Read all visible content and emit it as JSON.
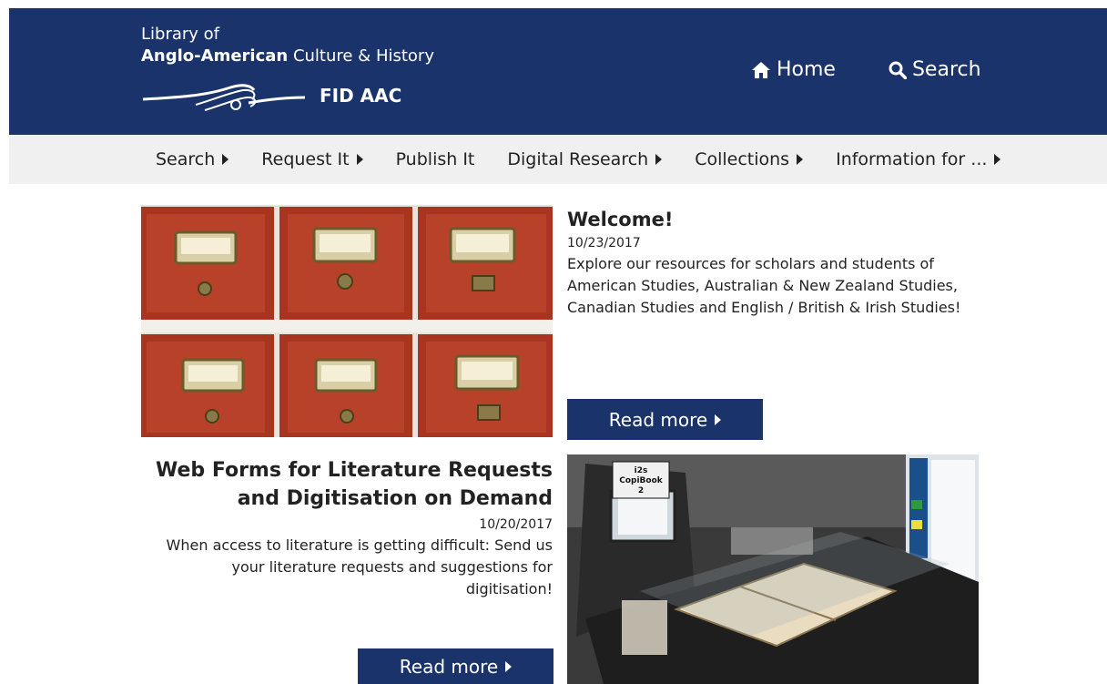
{
  "header": {
    "brand_line1": "Library of",
    "brand_line2_bold": "Anglo-American",
    "brand_line2_rest": " Culture & History",
    "brand_short": "FID AAC",
    "nav": [
      {
        "label": "Home",
        "icon": "home-icon"
      },
      {
        "label": "Search",
        "icon": "search-icon"
      }
    ]
  },
  "menu": {
    "items": [
      {
        "label": "Search",
        "has_arrow": true
      },
      {
        "label": "Request It",
        "has_arrow": true
      },
      {
        "label": "Publish It",
        "has_arrow": false
      },
      {
        "label": "Digital Research",
        "has_arrow": true
      },
      {
        "label": "Collections",
        "has_arrow": true
      },
      {
        "label": "Information for ...",
        "has_arrow": true
      }
    ]
  },
  "posts": [
    {
      "title": "Welcome!",
      "date": "10/23/2017",
      "text": "Explore our resources for scholars and students of American Studies, Australian & New Zealand Studies, Canadian Studies and English / British & Irish Studies!",
      "button": "Read more"
    },
    {
      "title": "Web Forms for Literature Requests and Digitisation on Demand",
      "date": "10/20/2017",
      "text": "When access to literature is getting difficult: Send us your literature requests and suggestions for digitisation!",
      "button": "Read more"
    }
  ],
  "images": {
    "scanner_label": "i2s CopiBook 2",
    "scanner_label_line1": "i2s",
    "scanner_label_line2": "CopiBook",
    "scanner_label_line3": "2"
  },
  "colors": {
    "brand_blue": "#1a336b",
    "menu_bg": "#f0f0f0",
    "drawer_red": "#b03a26"
  }
}
